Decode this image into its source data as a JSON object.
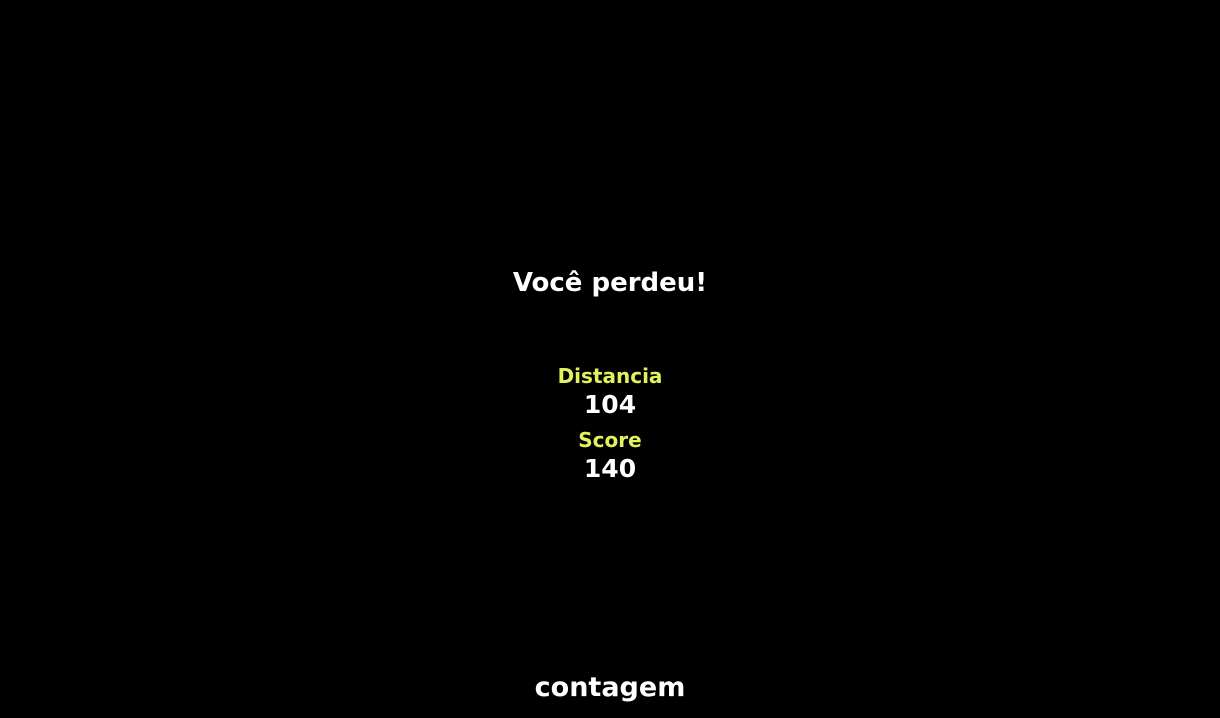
{
  "game_over": {
    "title": "Você perdeu!",
    "label_color": "#e2f25a",
    "text_color": "#ffffff",
    "stats": [
      {
        "label": "Distancia",
        "value": "104"
      },
      {
        "label": "Score",
        "value": "140"
      }
    ],
    "footer": "contagem"
  }
}
